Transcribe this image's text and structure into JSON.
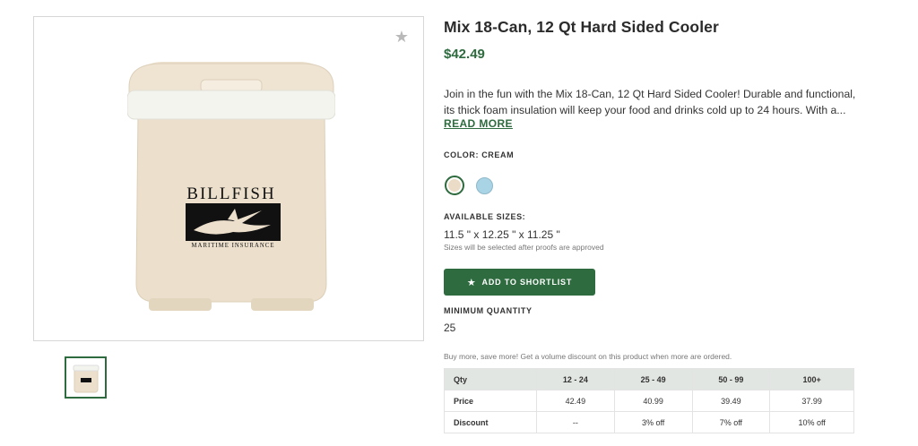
{
  "product": {
    "title": "Mix 18-Can, 12 Qt Hard Sided Cooler",
    "price": "$42.49",
    "description": "Join in the fun with the Mix 18-Can, 12 Qt Hard Sided Cooler! Durable and functional, its thick foam insulation will keep your food and drinks cold up to 24 hours. With a...",
    "read_more": "READ MORE",
    "image": {
      "brand_text": "BILLFISH",
      "tagline": "MARITIME INSURANCE",
      "favorite_icon": "star-icon"
    }
  },
  "color": {
    "label": "COLOR: CREAM",
    "options": [
      {
        "name": "Cream",
        "hex": "#eadcc6",
        "selected": true
      },
      {
        "name": "Light Blue",
        "hex": "#a9d4e6",
        "selected": false
      }
    ]
  },
  "sizes": {
    "label": "AVAILABLE SIZES:",
    "value": "11.5 \" x 12.25 \" x 11.25 \"",
    "note": "Sizes will be selected after proofs are approved"
  },
  "shortlist": {
    "label": "ADD TO SHORTLIST",
    "icon": "star-icon"
  },
  "minimum": {
    "label": "MINIMUM QUANTITY",
    "value": "25"
  },
  "pricing": {
    "note": "Buy more, save more! Get a volume discount on this product when more are ordered.",
    "headers": [
      "Qty",
      "12 - 24",
      "25 - 49",
      "50 - 99",
      "100+"
    ],
    "rows": [
      [
        "Price",
        "42.49",
        "40.99",
        "39.49",
        "37.99"
      ],
      [
        "Discount",
        "--",
        "3% off",
        "7% off",
        "10% off"
      ]
    ]
  },
  "colors": {
    "accent": "#2e6b3f",
    "table_header_bg": "#e2e6e2"
  }
}
